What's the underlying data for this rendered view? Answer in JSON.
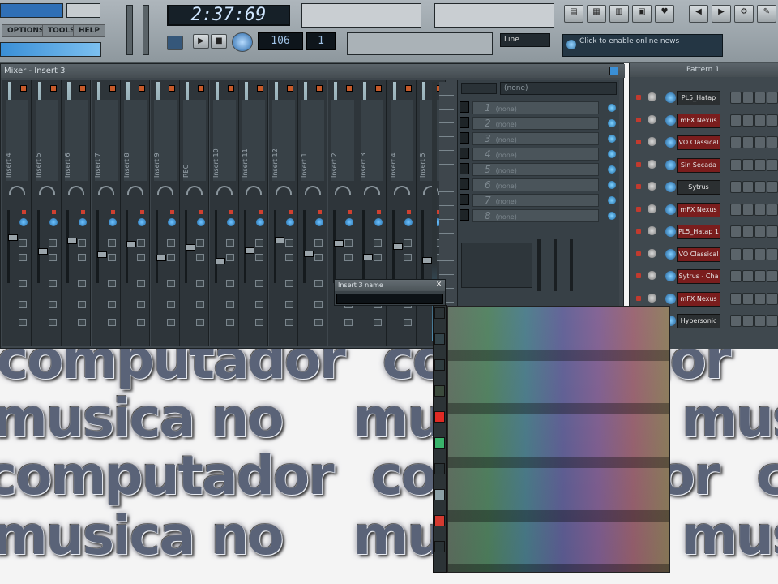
{
  "toolbar": {
    "menu": [
      "OPTIONS",
      "TOOLS",
      "HELP"
    ],
    "time": "2:37:69",
    "tempo": "106",
    "pattern": "1",
    "snap_value": "Line",
    "news_text": "Click to enable online news"
  },
  "mixer": {
    "title": "Mixer - Insert 3",
    "channels": [
      "Insert 4",
      "Insert 5",
      "Insert 6",
      "Insert 7",
      "Insert 8",
      "Insert 9",
      "REC",
      "Insert 10",
      "Insert 11",
      "Insert 12",
      "Insert 1",
      "Insert 2",
      "Insert 3",
      "Insert 4",
      "Insert 5"
    ],
    "fx_header_label": "(none)",
    "fx_slot_label": "(none)",
    "fx_slots": [
      "1",
      "2",
      "3",
      "4",
      "5",
      "6",
      "7",
      "8"
    ]
  },
  "rename_dialog": {
    "title": "Insert 3 name",
    "close": "✕",
    "value": ""
  },
  "palette": {
    "swatches": [
      "#2c3336",
      "#34444a",
      "#2f3c3f",
      "#3b4a3c",
      "#e02a24",
      "#39b46b",
      "#2a3235",
      "#8ca0a6",
      "#d43a30",
      "#2a3235"
    ]
  },
  "sequencer": {
    "title": "Pattern 1",
    "channels": [
      {
        "name": "PL5_Hatap",
        "style": "dark"
      },
      {
        "name": "mFX Nexus",
        "style": "red"
      },
      {
        "name": "VO Classical",
        "style": "red"
      },
      {
        "name": "Sin Secada",
        "style": "red"
      },
      {
        "name": "Sytrus",
        "style": "dark"
      },
      {
        "name": "mFX Nexus",
        "style": "red"
      },
      {
        "name": "PL5_Hatap 1",
        "style": "red"
      },
      {
        "name": "VO Classical",
        "style": "red"
      },
      {
        "name": "Sytrus - Cha",
        "style": "red"
      },
      {
        "name": "mFX Nexus",
        "style": "red"
      },
      {
        "name": "Hypersonic",
        "style": "dark"
      }
    ]
  },
  "wallpaper": {
    "line_a": "musica no",
    "line_b": "computador"
  },
  "colors": {
    "toolbar": "#9aa2a8",
    "mixer_bg": "#3e464c",
    "accent_blue": "#3a8fd6",
    "led_red": "#c23a2e",
    "desktop": "#f4f4f4"
  }
}
